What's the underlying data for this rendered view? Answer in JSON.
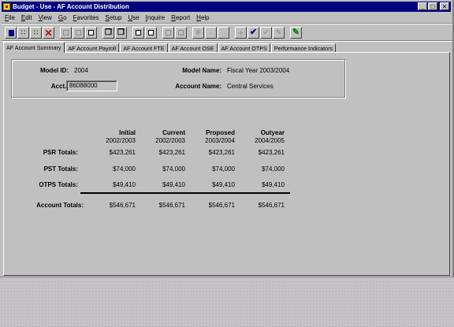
{
  "window": {
    "title": "Budget - Use - AF Account Distribution",
    "controls": {
      "minimize": "_",
      "restore": "□",
      "close": "×"
    }
  },
  "menu": [
    "File",
    "Edit",
    "View",
    "Go",
    "Favorites",
    "Setup",
    "Use",
    "Inquire",
    "Report",
    "Help"
  ],
  "toolbar": {
    "buttons": [
      {
        "icon": "save-icon",
        "enabled": true
      },
      {
        "icon": "abacus-icon",
        "enabled": true
      },
      {
        "icon": "abacus-plus-icon",
        "enabled": true
      },
      {
        "icon": "delete-x-icon",
        "enabled": true
      },
      {
        "icon": "grid-icon",
        "enabled": false
      },
      {
        "icon": "grid-icon",
        "enabled": false
      },
      {
        "icon": "grid-icon",
        "enabled": true
      },
      {
        "icon": "copy-icon",
        "enabled": true
      },
      {
        "icon": "copy-icon",
        "enabled": true
      },
      {
        "icon": "box-arrow-icon",
        "enabled": true
      },
      {
        "icon": "box-arrow-icon",
        "enabled": true
      },
      {
        "icon": "list-icon",
        "enabled": false
      },
      {
        "icon": "list-icon",
        "enabled": false
      },
      {
        "icon": "cog-icon",
        "enabled": false
      },
      {
        "icon": "arrow-left-icon",
        "enabled": false
      },
      {
        "icon": "arrow-right-icon",
        "enabled": false
      },
      {
        "icon": "plus-icon",
        "enabled": false
      },
      {
        "icon": "checkmark-icon",
        "enabled": true
      },
      {
        "icon": "checkmark-double-icon",
        "enabled": false
      },
      {
        "icon": "pencil-icon",
        "enabled": false
      },
      {
        "icon": "pencil-green-icon",
        "enabled": true
      }
    ]
  },
  "tabs": [
    {
      "label": "AF Account Summary",
      "active": true
    },
    {
      "label": "AF Account Payroll",
      "active": false
    },
    {
      "label": "AF Account FTE",
      "active": false
    },
    {
      "label": "AF Account OSE",
      "active": false
    },
    {
      "label": "AF Account OTPS",
      "active": false
    },
    {
      "label": "Performance Indicators",
      "active": false
    }
  ],
  "header": {
    "model_id_label": "Model ID:",
    "model_id": "2004",
    "acct_label": "Acct.:",
    "acct": "86088000",
    "model_name_label": "Model Name:",
    "model_name": "Fiscal Year 2003/2004",
    "account_name_label": "Account Name:",
    "account_name": "Central Services"
  },
  "summary": {
    "columns": [
      {
        "title": "Initial",
        "year": "2002/2003"
      },
      {
        "title": "Current",
        "year": "2002/2003"
      },
      {
        "title": "Proposed",
        "year": "2003/2004"
      },
      {
        "title": "Outyear",
        "year": "2004/2005"
      }
    ],
    "rows": [
      {
        "label": "PSR Totals:",
        "values": [
          "$423,261",
          "$423,261",
          "$423,261",
          "$423,261"
        ]
      },
      {
        "label": "PST Totals:",
        "values": [
          "$74,000",
          "$74,000",
          "$74,000",
          "$74,000"
        ]
      },
      {
        "label": "OTPS Totals:",
        "values": [
          "$49,410",
          "$49,410",
          "$49,410",
          "$49,410"
        ]
      },
      {
        "label": "Account Totals:",
        "values": [
          "$546,671",
          "$546,671",
          "$546,671",
          "$546,671"
        ]
      }
    ]
  }
}
